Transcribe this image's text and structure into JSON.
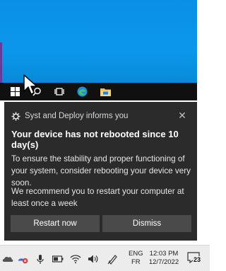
{
  "notification": {
    "app_name": "Syst and Deploy informs you",
    "title": "Your device has not rebooted since 10 day(s)",
    "body_1": "To ensure the stability and proper functioning of your system, consider rebooting your device very soon.",
    "body_2": "We recommend you to restart your computer at least once a week",
    "restart_label": "Restart now",
    "dismiss_label": "Dismiss",
    "close_glyph": "✕"
  },
  "preview_taskbar": {
    "icons": [
      "windows-start-icon",
      "search-icon",
      "task-view-icon",
      "edge-icon",
      "file-explorer-icon"
    ]
  },
  "taskbar": {
    "language_line1": "ENG",
    "language_line2": "FR",
    "time": "12:03 PM",
    "date": "12/7/2022",
    "notification_count": "23",
    "tray_icons": [
      "onedrive-icon",
      "network-error-icon",
      "microphone-icon",
      "battery-icon",
      "wifi-icon",
      "volume-icon",
      "pen-icon"
    ]
  },
  "colors": {
    "wallpaper": "#0b97ec",
    "toast_background": "#2b2b2b",
    "button_background": "#4a4a4a",
    "taskbar_background": "#ececec"
  }
}
